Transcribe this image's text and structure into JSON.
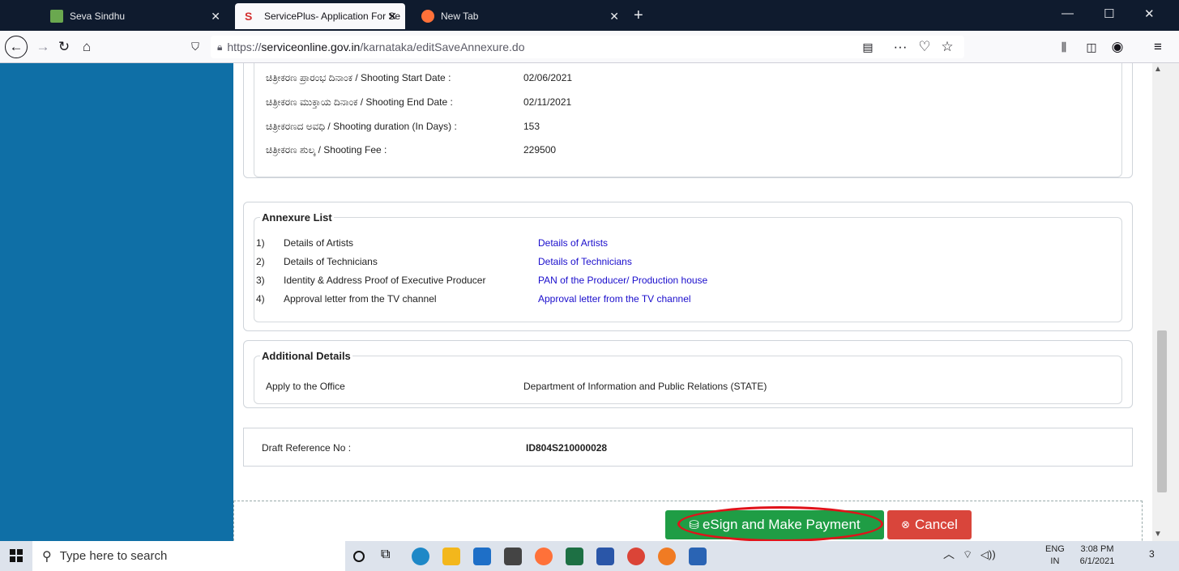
{
  "browser": {
    "tabs": [
      {
        "title": "Seva Sindhu"
      },
      {
        "title": "ServicePlus- Application For Se"
      },
      {
        "title": "New Tab"
      }
    ],
    "url_prefix": "https://",
    "url_host": "serviceonline.gov.in",
    "url_path": "/karnataka/editSaveAnnexure.do"
  },
  "shooting": {
    "start_label": "ಚಿತ್ರೀಕರಣ ಪ್ರಾರಂಭ ದಿನಾಂಕ / Shooting Start Date :",
    "start_value": "02/06/2021",
    "end_label": "ಚಿತ್ರೀಕರಣ ಮುಕ್ತಾಯ ದಿನಾಂಕ / Shooting End Date :",
    "end_value": "02/11/2021",
    "duration_label": "ಚಿತ್ರೀಕರಣದ ಅವಧಿ / Shooting duration (In Days) :",
    "duration_value": "153",
    "fee_label": "ಚಿತ್ರೀಕರಣ ಶುಲ್ಕ / Shooting Fee :",
    "fee_value": "229500"
  },
  "annexure": {
    "title": "Annexure List",
    "items": [
      {
        "num": "1)",
        "name": "Details of Artists",
        "link": "Details of Artists"
      },
      {
        "num": "2)",
        "name": "Details of Technicians",
        "link": "Details of Technicians"
      },
      {
        "num": "3)",
        "name": "Identity & Address Proof of Executive Producer",
        "link": "PAN of the Producer/ Production house"
      },
      {
        "num": "4)",
        "name": "Approval letter from the TV channel",
        "link": "Approval letter from the TV channel"
      }
    ]
  },
  "additional": {
    "title": "Additional Details",
    "office_label": "Apply to the Office",
    "office_value": "Department of Information and Public Relations (STATE)"
  },
  "draft": {
    "label": "Draft Reference No :",
    "value": "ID804S210000028"
  },
  "actions": {
    "esign_label": "eSign and Make Payment",
    "cancel_label": "Cancel"
  },
  "taskbar": {
    "search_placeholder": "Type here to search",
    "lang_top": "ENG",
    "lang_bottom": "IN",
    "time": "3:08 PM",
    "date": "6/1/2021",
    "notif_count": "3"
  },
  "colors": {
    "accent": "#0f6fa6",
    "esign": "#1f9d45",
    "cancel": "#d9453b",
    "highlight": "#e0131a"
  }
}
